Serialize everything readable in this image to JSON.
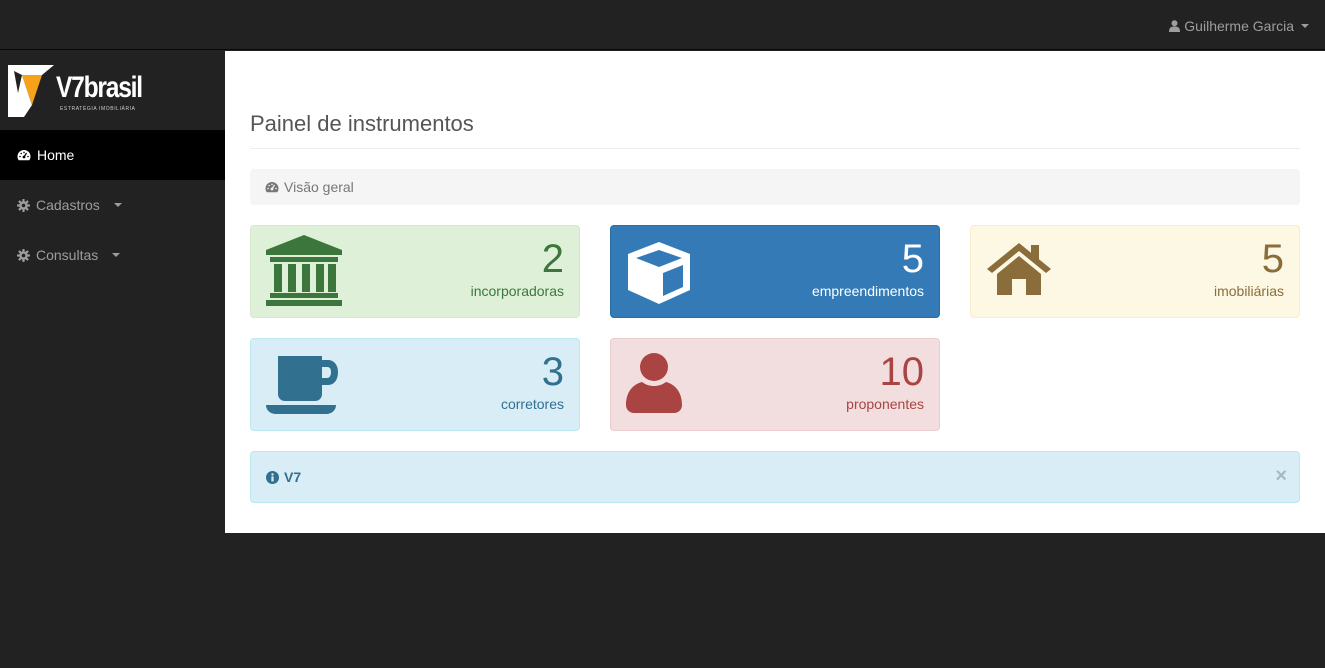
{
  "topbar": {
    "user_name": "Guilherme Garcia",
    "user_icon": "user-icon"
  },
  "brand": {
    "name": "V7brasil",
    "tagline": "ESTRATÉGIA IMOBILIÁRIA"
  },
  "sidebar": {
    "items": [
      {
        "label": "Home",
        "icon": "dashboard-icon",
        "active": true
      },
      {
        "label": "Cadastros",
        "icon": "gear-icon",
        "dropdown": true
      },
      {
        "label": "Consultas",
        "icon": "gear-icon",
        "dropdown": true
      }
    ]
  },
  "main": {
    "title": "Painel de instrumentos",
    "breadcrumb": "Visão geral",
    "cards": [
      {
        "value": "2",
        "label": "incorporadoras",
        "icon": "bank-icon",
        "color": "#3c763d"
      },
      {
        "value": "5",
        "label": "empreendimentos",
        "icon": "cube-icon",
        "color": "#ffffff"
      },
      {
        "value": "5",
        "label": "imobiliárias",
        "icon": "home-icon",
        "color": "#8a6d3b"
      },
      {
        "value": "3",
        "label": "corretores",
        "icon": "coffee-icon",
        "color": "#31708f"
      },
      {
        "value": "10",
        "label": "proponentes",
        "icon": "user-icon",
        "color": "#a94442"
      }
    ],
    "alert": {
      "text": "V7",
      "close": "×"
    }
  }
}
